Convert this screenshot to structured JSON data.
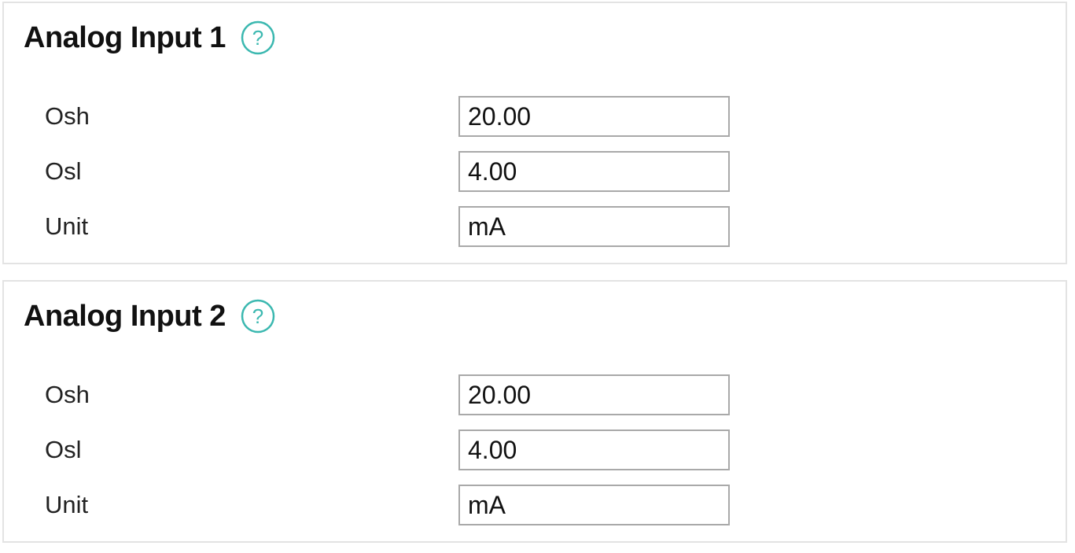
{
  "accent_color": "#3bb8b0",
  "panels": [
    {
      "title": "Analog Input 1",
      "help_icon": "help-circle-icon",
      "fields": {
        "osh": {
          "label": "Osh",
          "value": "20.00"
        },
        "osl": {
          "label": "Osl",
          "value": "4.00"
        },
        "unit": {
          "label": "Unit",
          "value": "mA"
        }
      }
    },
    {
      "title": "Analog Input 2",
      "help_icon": "help-circle-icon",
      "fields": {
        "osh": {
          "label": "Osh",
          "value": "20.00"
        },
        "osl": {
          "label": "Osl",
          "value": "4.00"
        },
        "unit": {
          "label": "Unit",
          "value": "mA"
        }
      }
    }
  ]
}
